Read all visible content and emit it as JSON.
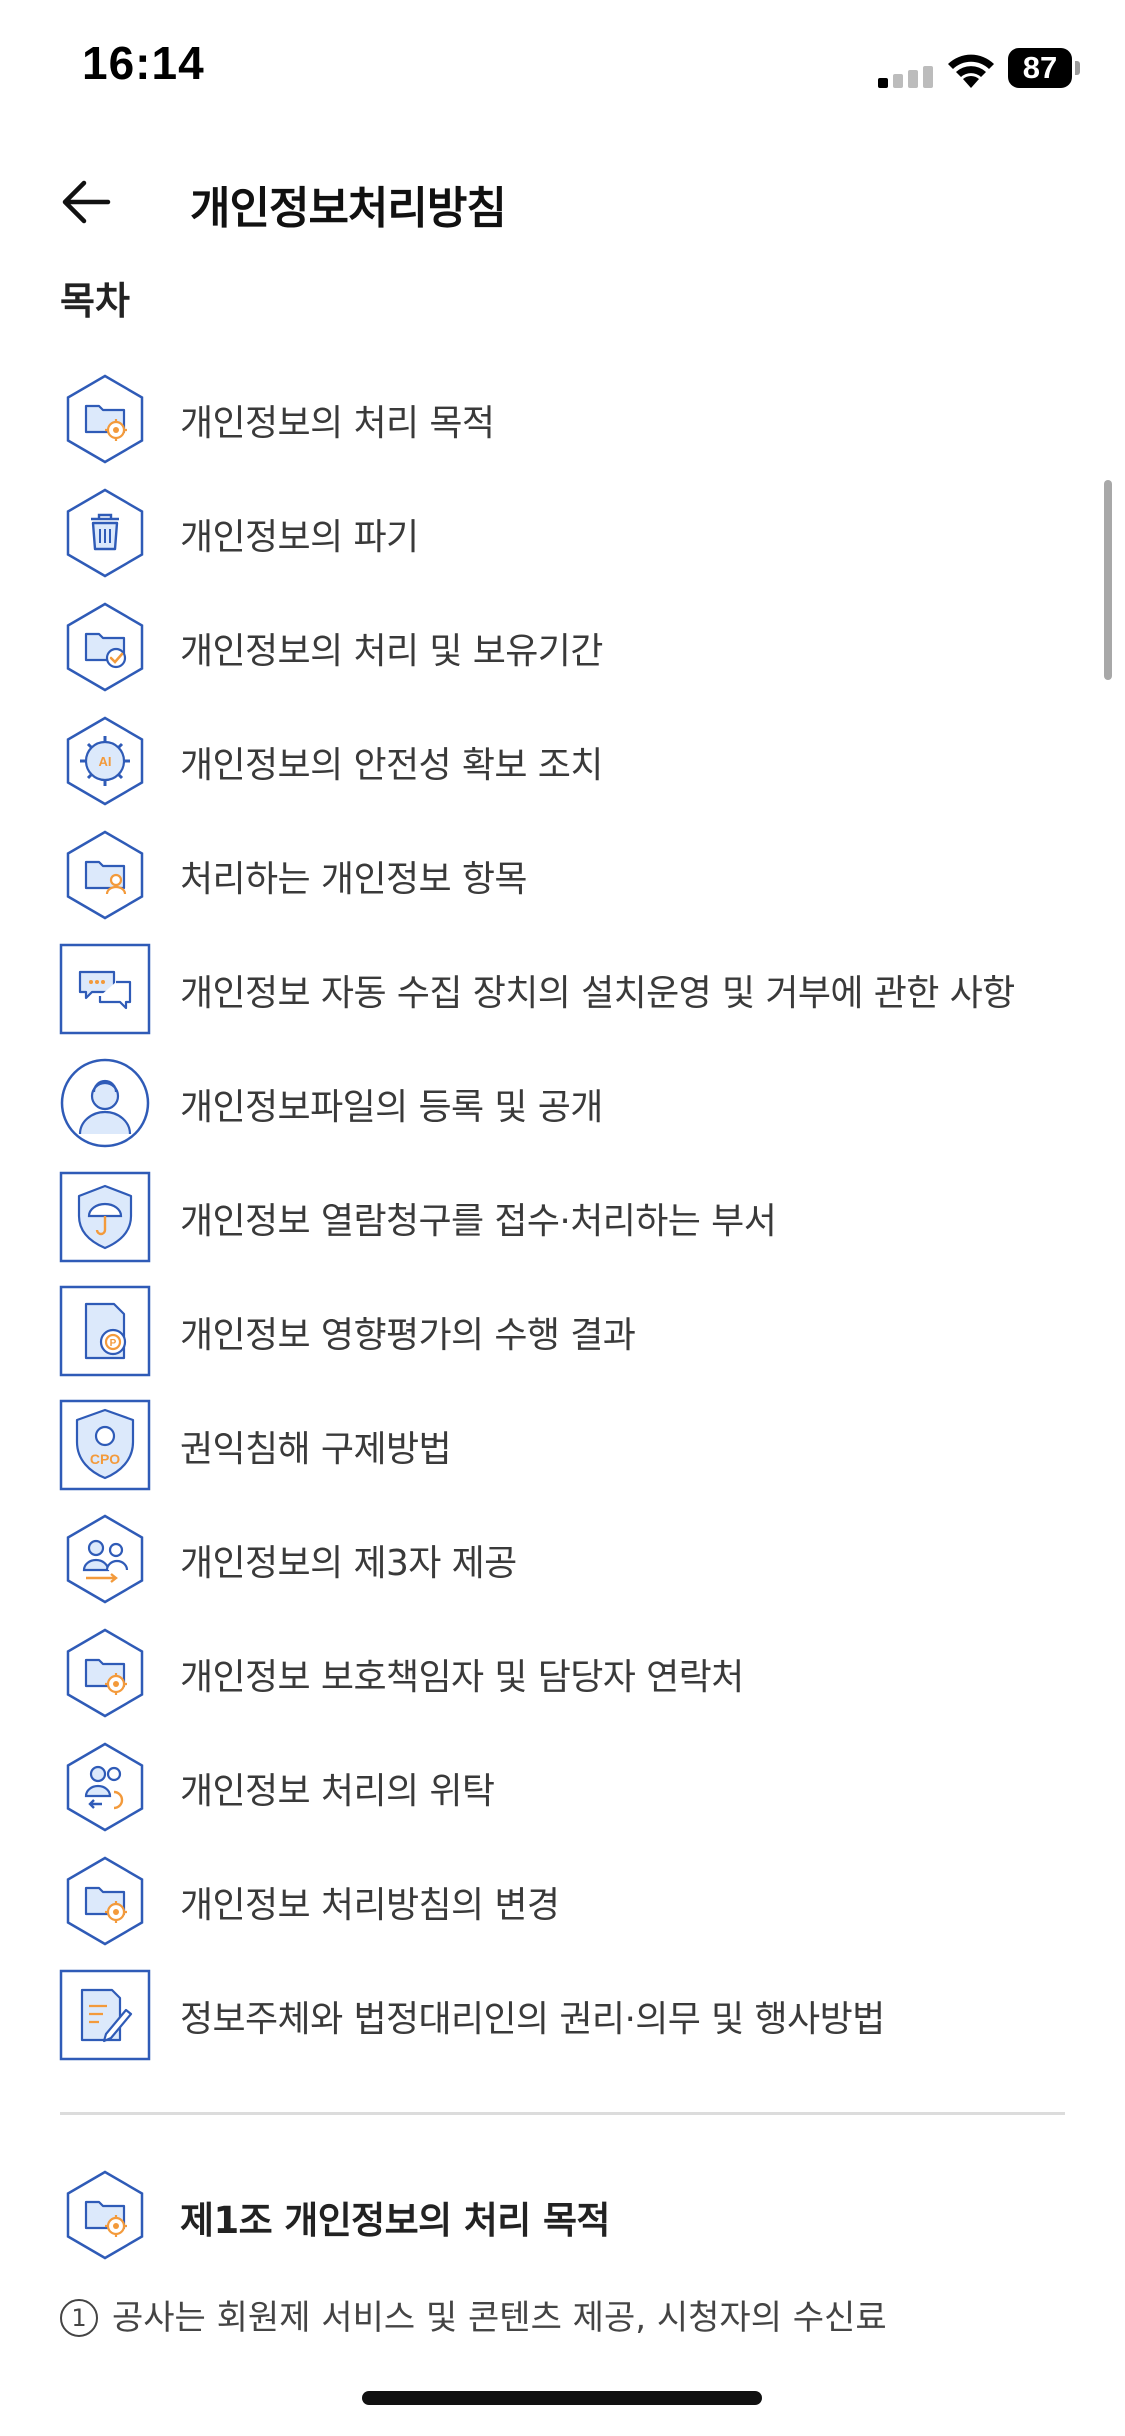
{
  "status_bar": {
    "time": "16:14",
    "battery": "87"
  },
  "header": {
    "title": "개인정보처리방침"
  },
  "toc": {
    "heading": "목차",
    "items": [
      {
        "label": "개인정보의 처리 목적",
        "icon": "folder-gear-icon",
        "shape": "hex"
      },
      {
        "label": "개인정보의 파기",
        "icon": "trash-icon",
        "shape": "hex"
      },
      {
        "label": "개인정보의 처리 및 보유기간",
        "icon": "folder-clock-icon",
        "shape": "hex"
      },
      {
        "label": "개인정보의 안전성 확보 조치",
        "icon": "folder-ai-gear-icon",
        "shape": "hex"
      },
      {
        "label": "처리하는 개인정보 항목",
        "icon": "folder-user-icon",
        "shape": "hex"
      },
      {
        "label": "개인정보 자동 수집 장치의 설치운영 및 거부에 관한 사항",
        "icon": "chat-bubbles-icon",
        "shape": "square"
      },
      {
        "label": "개인정보파일의 등록 및 공개",
        "icon": "user-profile-icon",
        "shape": "circle"
      },
      {
        "label": "개인정보 열람청구를 접수·처리하는 부서",
        "icon": "shield-umbrella-icon",
        "shape": "square"
      },
      {
        "label": "개인정보 영향평가의 수행 결과",
        "icon": "document-badge-icon",
        "shape": "square"
      },
      {
        "label": "권익침해 구제방법",
        "icon": "cpo-shield-icon",
        "shape": "square"
      },
      {
        "label": "개인정보의 제3자 제공",
        "icon": "users-share-icon",
        "shape": "hex"
      },
      {
        "label": "개인정보 보호책임자 및 담당자 연락처",
        "icon": "folder-gear-icon",
        "shape": "hex"
      },
      {
        "label": "개인정보 처리의 위탁",
        "icon": "users-transfer-icon",
        "shape": "hex"
      },
      {
        "label": "개인정보 처리방침의 변경",
        "icon": "folder-gear-icon",
        "shape": "hex"
      },
      {
        "label": "정보주체와 법정대리인의 권리·의무 및 행사방법",
        "icon": "document-pen-icon",
        "shape": "square"
      }
    ]
  },
  "section": {
    "title": "제1조 개인정보의 처리 목적",
    "icon": "folder-gear-icon",
    "number": "1",
    "body": "공사는 회원제 서비스 및 콘텐츠 제공, 시청자의 수신료"
  },
  "colors": {
    "icon_blue": "#2f5bb7",
    "icon_fill": "#dce9fb",
    "icon_orange": "#f39a3b"
  }
}
